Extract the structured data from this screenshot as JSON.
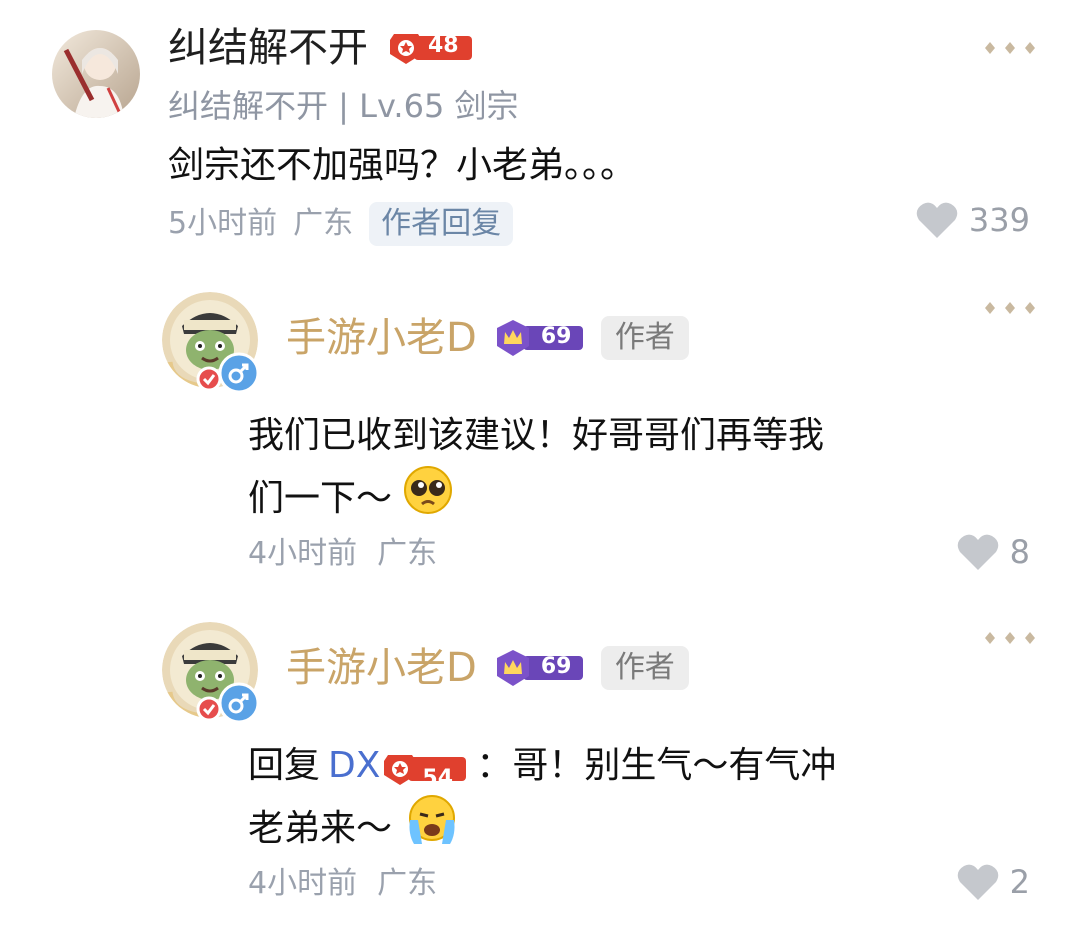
{
  "comment": {
    "username": "纠结解不开",
    "level_badge": "48",
    "subline": "纠结解不开 | Lv.65 剑宗",
    "text": "剑宗还不加强吗？小老弟。。。",
    "time": "5小时前",
    "region": "广东",
    "author_reply_tag": "作者回复",
    "likes": "339"
  },
  "replies": [
    {
      "username": "手游小老D",
      "level_badge": "69",
      "author_label": "作者",
      "text_line1": "我们已收到该建议！好哥哥们再等我",
      "text_line2": "们一下～",
      "emoji": "pleading-face",
      "time": "4小时前",
      "region": "广东",
      "likes": "8"
    },
    {
      "username": "手游小老D",
      "level_badge": "69",
      "author_label": "作者",
      "reply_prefix": "回复",
      "reply_target": "DX",
      "reply_target_badge": "54",
      "text_line1_suffix": "：哥！别生气～有气冲",
      "text_line2": "老弟来～",
      "emoji": "crying-face",
      "time": "4小时前",
      "region": "广东",
      "likes": "2"
    }
  ],
  "colors": {
    "dev_name": "#c9a468",
    "meta": "#9aa1ad",
    "reply_link": "#4a6fcf",
    "level_badge_red": "#e0402e",
    "level_badge_purple": "#7b52c9"
  }
}
